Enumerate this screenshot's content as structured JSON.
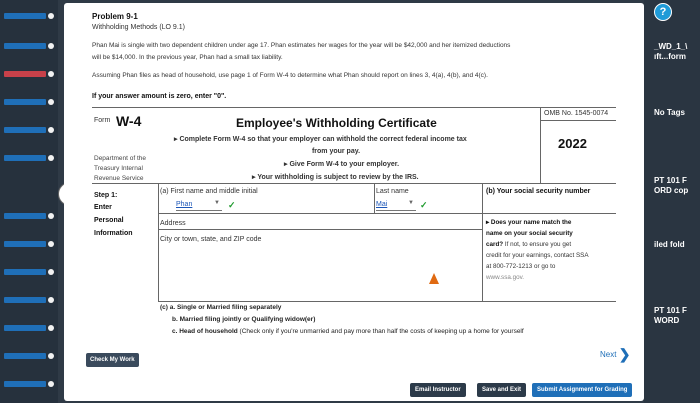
{
  "problem": {
    "title": "Problem 9-1",
    "subtitle": "Withholding Methods (LO 9.1)",
    "para1_line1": "Phan Mai is single with two dependent children under age 17. Phan estimates her wages for the year will be $42,000 and her itemized deductions",
    "para1_line2": "will be $14,000. In the previous year, Phan had a small tax liability.",
    "para2": "Assuming Phan files as head of household, use page 1 of Form W-4 to determine what Phan should report on lines 3, 4(a), 4(b), and 4(c).",
    "zero_note": "If your answer amount is zero, enter \"0\"."
  },
  "form": {
    "form_label": "Form",
    "form_name": "W-4",
    "title": "Employee's Withholding Certificate",
    "instr1": "▸ Complete Form W-4 so that your employer can withhold the correct federal income tax",
    "instr1b": "from your pay.",
    "instr2": "▸ Give Form W-4 to your employer.",
    "instr3": "▸ Your withholding is subject to review by the IRS.",
    "omb": "OMB No. 1545-0074",
    "year": "2022",
    "dept1": "Department of the",
    "dept2": "Treasury Internal",
    "dept3": "Revenue Service",
    "step1": "Step 1:",
    "step1b": "Enter",
    "step1c": "Personal",
    "step1d": "Information",
    "first_name_label": "(a) First name and middle initial",
    "first_name_value": "Phan",
    "last_name_label": "Last name",
    "last_name_value": "Mai",
    "ssn_label": "(b) Your social security number",
    "address_label": "Address",
    "city_label": "City or town, state, and ZIP code",
    "note_title1": "▸ Does your name match the",
    "note_title2": "name on your social security",
    "note_title3": "card?",
    "note_rest1": " If not, to ensure you get",
    "note_rest2": "credit for your earnings, contact SSA",
    "note_rest3": "at 800-772-1213 or go to",
    "note_link": "www.ssa.gov.",
    "filing_a": "(c) a. Single or Married filing separately",
    "filing_b": "b. Married filing jointly or Qualifying widow(er)",
    "filing_c_bold": "c. Head of household",
    "filing_c_rest": " (Check only if you're unmarried and pay more than half the costs of keeping up a home for yourself"
  },
  "buttons": {
    "check_work": "Check My Work",
    "next": "Next",
    "email": "Email Instructor",
    "save": "Save and Exit",
    "submit": "Submit Assignment for Grading"
  },
  "right_sidebar": {
    "item1": "_WD_1_\\\nıft...form",
    "item2": "No Tags",
    "item3": "PT 101 F\nORD cop",
    "item4": "iled fold",
    "item5": "PT 101 F\nWORD"
  },
  "colors": {
    "accent": "#1f6fb8",
    "check": "#1f9b2e",
    "cursor": "#e06a12"
  }
}
